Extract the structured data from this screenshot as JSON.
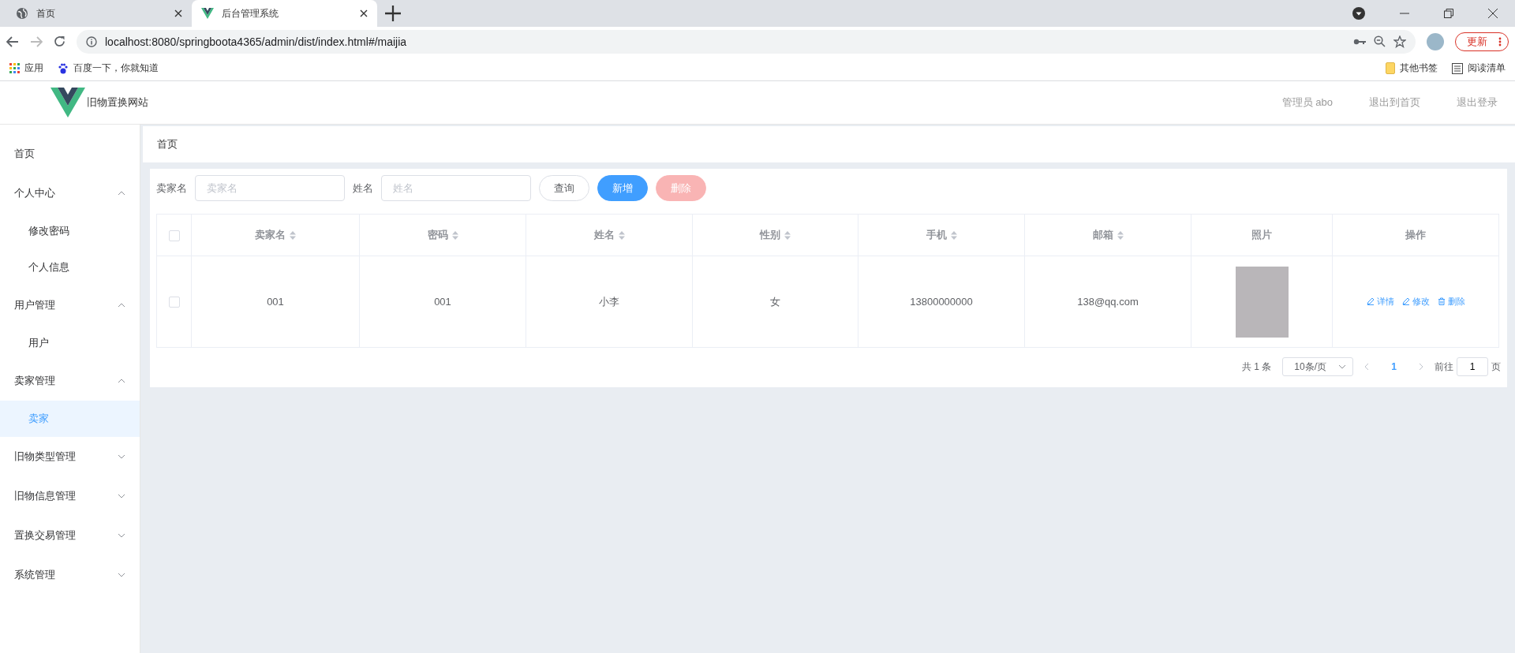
{
  "browser": {
    "tabs": [
      {
        "title": "首页",
        "kind": "web",
        "selected": false
      },
      {
        "title": "后台管理系统",
        "kind": "app",
        "selected": true
      }
    ],
    "url": "localhost:8080/springboota4365/admin/dist/index.html#/maijia",
    "update_button": "更新",
    "bookmarks": [
      {
        "label": "应用",
        "kind": "apps"
      },
      {
        "label": "百度一下，你就知道",
        "kind": "paw"
      }
    ],
    "bookmarks_right": [
      {
        "label": "其他书签",
        "kind": "folder"
      },
      {
        "label": "阅读清单",
        "kind": "list"
      }
    ]
  },
  "header": {
    "site_title": "旧物置换网站",
    "links": [
      "管理员 abo",
      "退出到首页",
      "退出登录"
    ]
  },
  "sidebar": {
    "items": [
      {
        "label": "首页",
        "selected": false
      },
      {
        "label": "个人中心",
        "expanded": true,
        "selected": false,
        "children": [
          {
            "label": "修改密码",
            "selected": false
          },
          {
            "label": "个人信息",
            "selected": false
          }
        ]
      },
      {
        "label": "用户管理",
        "expanded": true,
        "selected": false,
        "children": [
          {
            "label": "用户",
            "selected": false
          }
        ]
      },
      {
        "label": "卖家管理",
        "expanded": true,
        "selected": false,
        "children": [
          {
            "label": "卖家",
            "selected": true
          }
        ]
      },
      {
        "label": "旧物类型管理",
        "expanded": false,
        "selected": false
      },
      {
        "label": "旧物信息管理",
        "expanded": false,
        "selected": false
      },
      {
        "label": "置换交易管理",
        "expanded": false,
        "selected": false
      },
      {
        "label": "系统管理",
        "expanded": false,
        "selected": false
      }
    ]
  },
  "breadcrumb": [
    "首页"
  ],
  "filters": {
    "fields": [
      {
        "label": "卖家名",
        "placeholder": "卖家名"
      },
      {
        "label": "姓名",
        "placeholder": "姓名"
      }
    ],
    "buttons": [
      {
        "label": "查询",
        "kind": "default",
        "disabled": false
      },
      {
        "label": "新增",
        "kind": "primary",
        "disabled": false
      },
      {
        "label": "删除",
        "kind": "danger",
        "disabled": true
      }
    ]
  },
  "table": {
    "select_all": {
      "checked": false
    },
    "columns": [
      {
        "label": "卖家名",
        "kind": "text",
        "sortable": true
      },
      {
        "label": "密码",
        "kind": "text",
        "sortable": true
      },
      {
        "label": "姓名",
        "kind": "text",
        "sortable": true
      },
      {
        "label": "性别",
        "kind": "text",
        "sortable": true
      },
      {
        "label": "手机",
        "kind": "text",
        "sortable": true
      },
      {
        "label": "邮箱",
        "kind": "text",
        "sortable": true
      },
      {
        "label": "照片",
        "kind": "photo",
        "sortable": false
      },
      {
        "label": "操作",
        "kind": "actions",
        "sortable": false
      }
    ],
    "rows": [
      {
        "selected": false,
        "cells": [
          "001",
          "001",
          "小李",
          "女",
          "13800000000",
          "138@qq.com"
        ],
        "actions": [
          {
            "label": "详情",
            "kind": "view"
          },
          {
            "label": "修改",
            "kind": "edit"
          },
          {
            "label": "删除",
            "kind": "delete"
          }
        ]
      }
    ]
  },
  "pagination": {
    "total": "共 1 条",
    "page_size": "10条/页",
    "pages": [
      {
        "label": "1",
        "selected": true
      }
    ],
    "jump_label": "前往",
    "jump_value": "1",
    "jump_suffix": "页"
  }
}
